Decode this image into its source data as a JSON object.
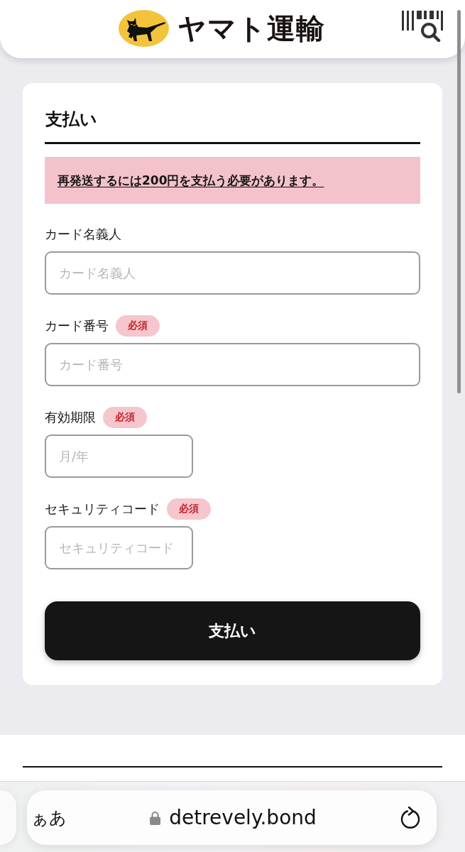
{
  "header": {
    "logo_text": "ヤマト運輸"
  },
  "payment": {
    "title": "支払い",
    "notice": "再発送するには200円を支払う必要があります。",
    "fields": [
      {
        "label": "カード名義人",
        "placeholder": "カード名義人",
        "kind": "wide"
      },
      {
        "label": "カード番号",
        "badge": "必須",
        "placeholder": "カード番号",
        "kind": "wide"
      },
      {
        "label": "有効期限",
        "badge": "必須",
        "placeholder": "月/年",
        "kind": "short"
      },
      {
        "label": "セキュリティコード",
        "badge": "必須",
        "placeholder": "セキュリティコード",
        "kind": "short"
      }
    ],
    "submit": "支払い"
  },
  "browser": {
    "text_size_button": "ぁあ",
    "url": "detrevely.bond"
  }
}
